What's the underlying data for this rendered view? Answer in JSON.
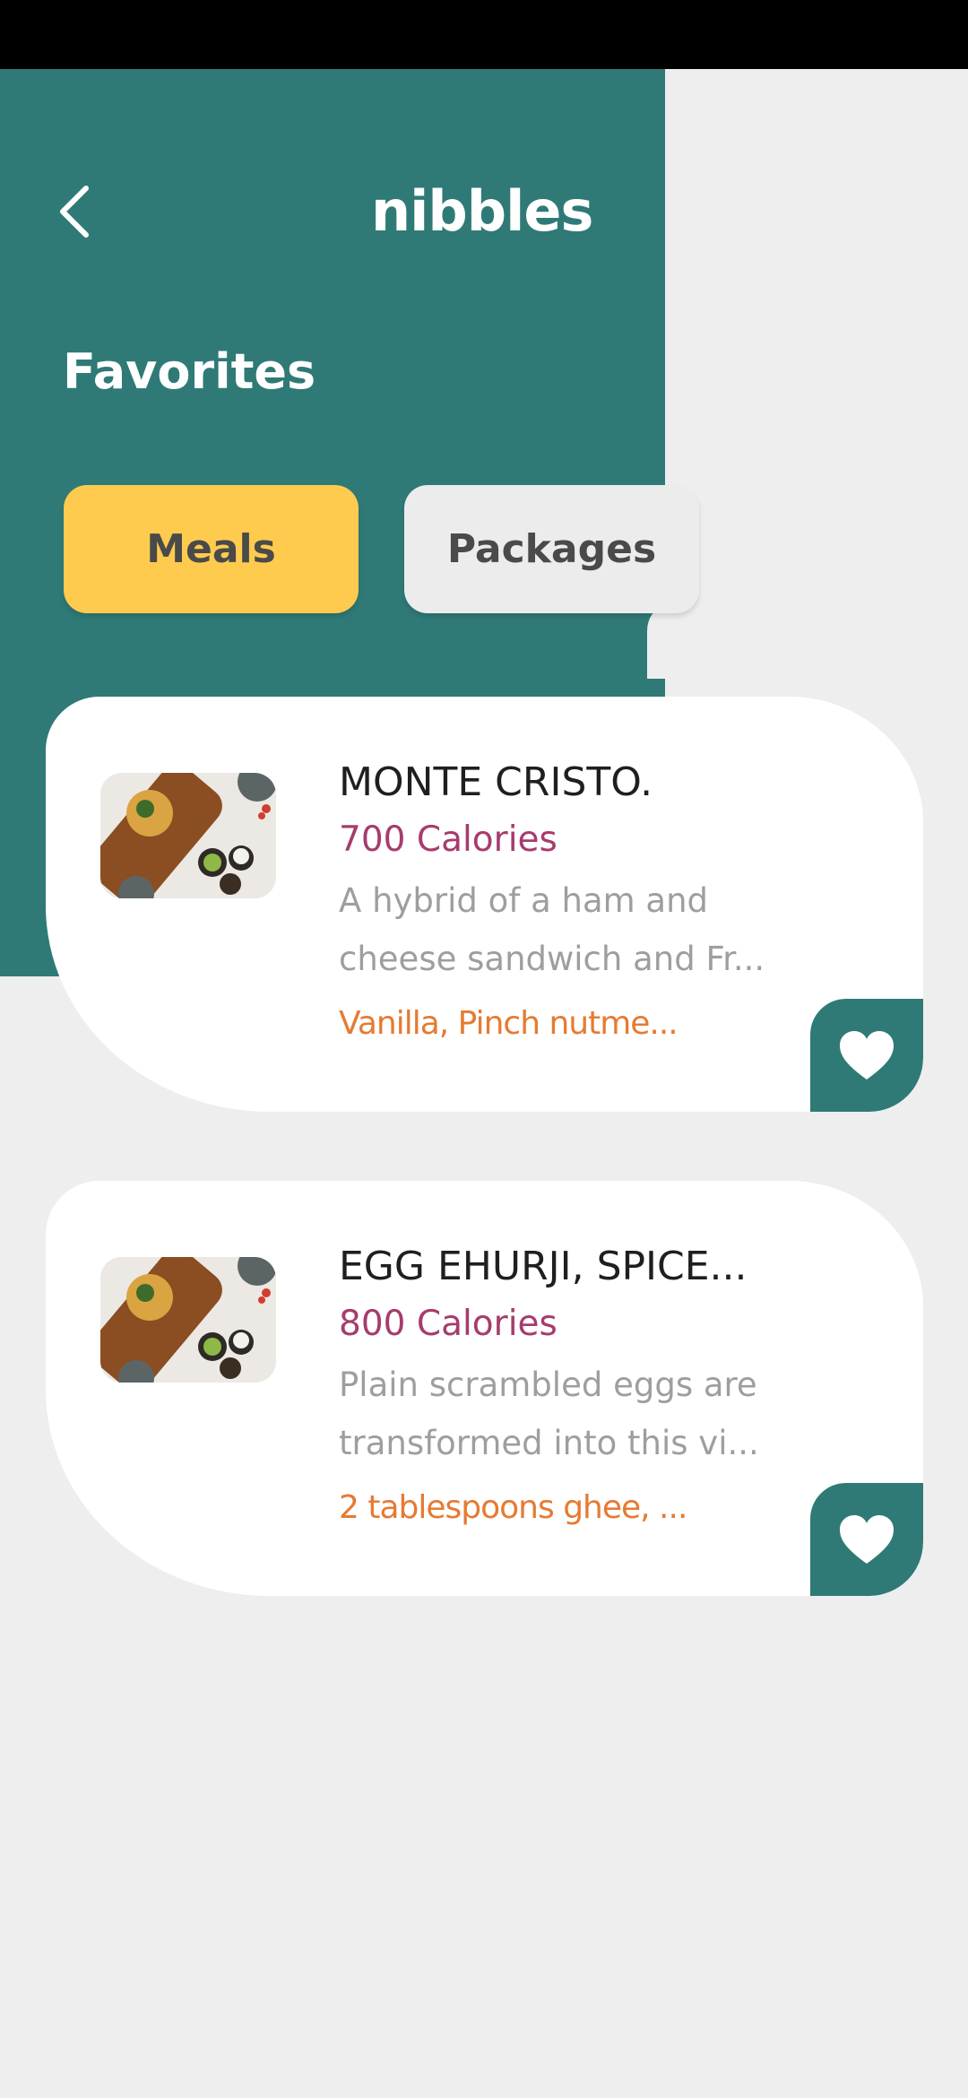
{
  "header": {
    "logo": "nibbles",
    "title": "Favorites",
    "back_icon": "chevron-left-icon"
  },
  "tabs": [
    {
      "label": "Meals",
      "active": true
    },
    {
      "label": "Packages",
      "active": false
    }
  ],
  "favorites": [
    {
      "title": "MONTE CRISTO.",
      "calories": "700 Calories",
      "description_line1": "A hybrid of a ham and",
      "description_line2": "cheese sandwich and Fr...",
      "ingredients": "Vanilla, Pinch nutme...",
      "favorite_icon": "heart-icon"
    },
    {
      "title": "EGG EHURJI, SPICE...",
      "calories": "800 Calories",
      "description_line1": "Plain scrambled eggs are",
      "description_line2": "transformed into this vi...",
      "ingredients": "2 tablespoons ghee, ...",
      "favorite_icon": "heart-icon"
    }
  ],
  "colors": {
    "teal": "#2f7a77",
    "yellow": "#fecb4e",
    "calories": "#a63c6e",
    "ingredients": "#e67a32",
    "background": "#eeeeee"
  }
}
